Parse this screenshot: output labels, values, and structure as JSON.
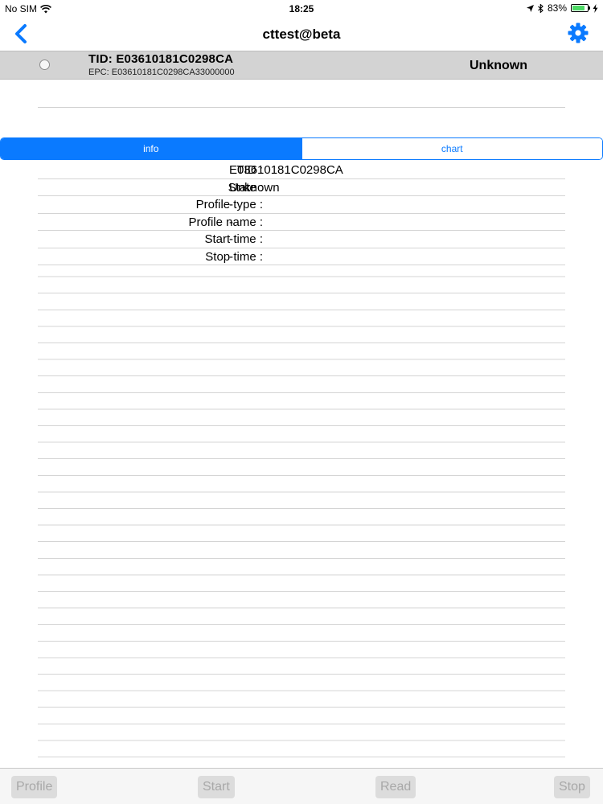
{
  "status_bar": {
    "carrier": "No SIM",
    "time": "18:25",
    "battery_percent_label": "83%",
    "battery_level": 0.83
  },
  "nav": {
    "title": "cttest@beta",
    "icons": {
      "back": "chevron-left-icon",
      "settings": "gear-icon"
    },
    "accent_color": "#0a7aff"
  },
  "selected_tag": {
    "tid_line": "TID: E03610181C0298CA",
    "epc_line": "EPC: E03610181C0298CA33000000",
    "state": "Unknown"
  },
  "tabs": [
    {
      "label": "info",
      "active": true
    },
    {
      "label": "chart",
      "active": false
    }
  ],
  "info": {
    "rows": [
      {
        "label": "TID :",
        "value": "E03610181C0298CA"
      },
      {
        "label": "State :",
        "value": "Unknown"
      },
      {
        "label": "Profile type :",
        "value": "-"
      },
      {
        "label": "Profile name :",
        "value": "-"
      },
      {
        "label": "Start time :",
        "value": "-"
      },
      {
        "label": "Stop time :",
        "value": "-"
      }
    ]
  },
  "toolbar": {
    "profile_label": "Profile",
    "start_label": "Start",
    "read_label": "Read",
    "stop_label": "Stop"
  }
}
